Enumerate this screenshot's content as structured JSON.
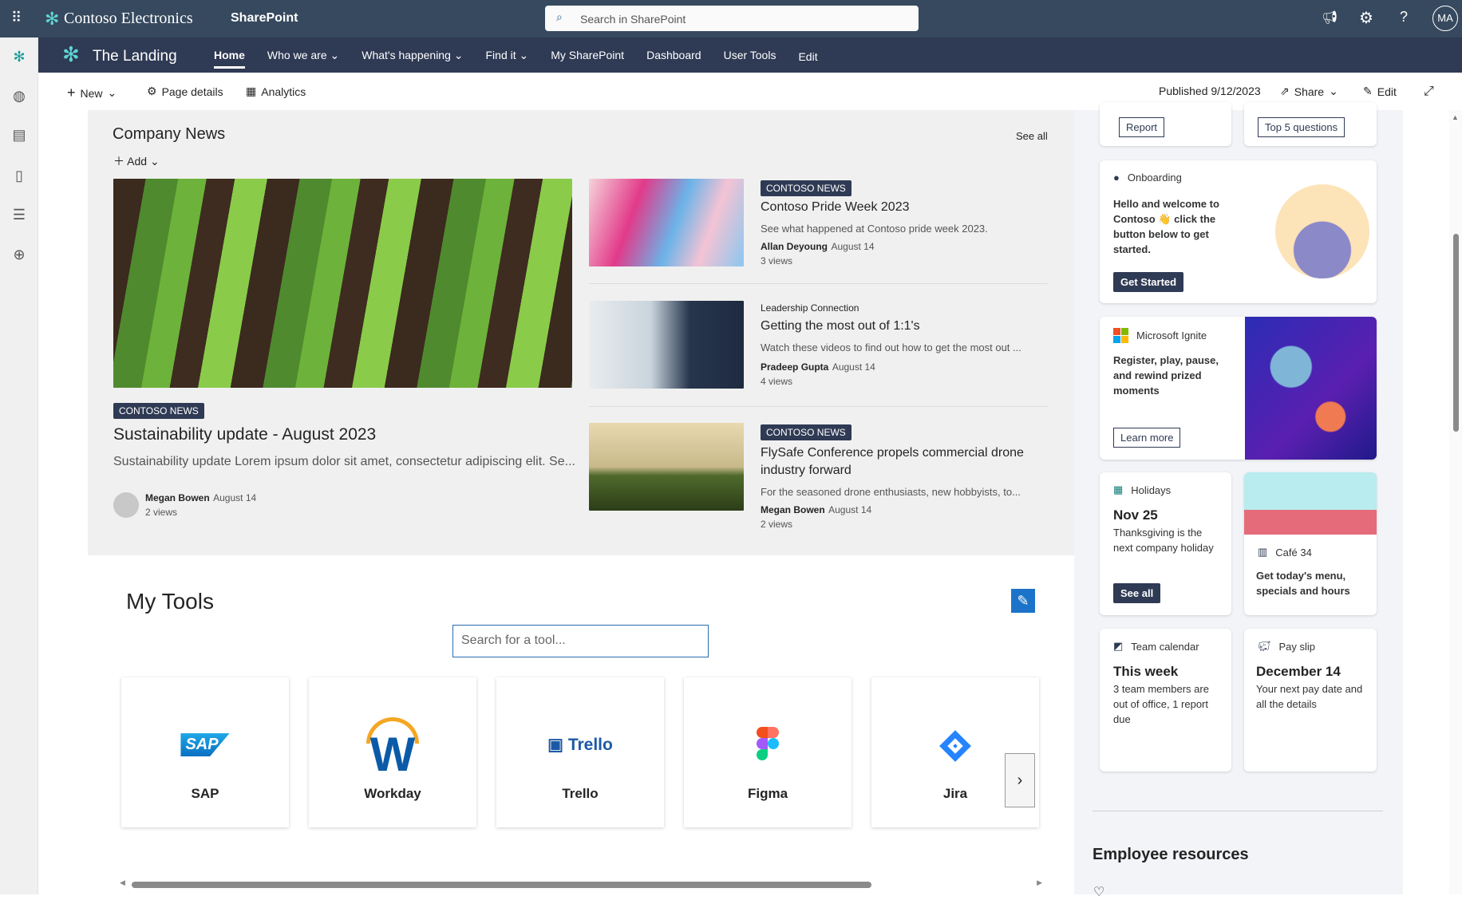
{
  "suite": {
    "org": "Contoso Electronics",
    "app": "SharePoint",
    "search_placeholder": "Search in SharePoint",
    "avatar": "MA"
  },
  "site": {
    "name": "The Landing",
    "nav": [
      {
        "label": "Home"
      },
      {
        "label": "Who we are"
      },
      {
        "label": "What's happening"
      },
      {
        "label": "Find it"
      },
      {
        "label": "My SharePoint"
      },
      {
        "label": "Dashboard"
      },
      {
        "label": "User Tools"
      },
      {
        "label": "Edit"
      }
    ]
  },
  "toolbar": {
    "new": "New",
    "page_details": "Page details",
    "analytics": "Analytics",
    "published": "Published 9/12/2023",
    "share": "Share",
    "edit": "Edit"
  },
  "news": {
    "title": "Company News",
    "see_all": "See all",
    "add": "Add",
    "hero": {
      "badge": "CONTOSO NEWS",
      "title": "Sustainability update - August 2023",
      "desc": "Sustainability update Lorem ipsum dolor sit amet, consectetur adipiscing elit. Se...",
      "author": "Megan Bowen",
      "date": "August 14",
      "views": "2 views"
    },
    "items": [
      {
        "badge": "CONTOSO NEWS",
        "title": "Contoso Pride Week 2023",
        "desc": "See what happened at Contoso pride week 2023.",
        "author": "Allan Deyoung",
        "date": "August 14",
        "views": "3 views"
      },
      {
        "category": "Leadership Connection",
        "title": "Getting the most out of 1:1's",
        "desc": "Watch these videos to find out how to get the most out ...",
        "author": "Pradeep Gupta",
        "date": "August 14",
        "views": "4 views"
      },
      {
        "badge": "CONTOSO NEWS",
        "title": "FlySafe Conference propels commercial drone industry forward",
        "desc": "For the seasoned drone enthusiasts, new hobbyists, to...",
        "author": "Megan Bowen",
        "date": "August 14",
        "views": "2 views"
      }
    ]
  },
  "tools": {
    "title": "My Tools",
    "search_placeholder": "Search for a tool...",
    "items": [
      {
        "label": "SAP"
      },
      {
        "label": "Workday"
      },
      {
        "label": "Trello"
      },
      {
        "label": "Figma"
      },
      {
        "label": "Jira"
      }
    ]
  },
  "right": {
    "report": "Report",
    "top5": "Top 5 questions",
    "onboarding": {
      "header": "Onboarding",
      "body": "Hello and welcome to Contoso 👋 click the button below to get started.",
      "button": "Get Started"
    },
    "ignite": {
      "header": "Microsoft Ignite",
      "body": "Register, play, pause, and rewind prized moments",
      "button": "Learn more"
    },
    "holidays": {
      "header": "Holidays",
      "big": "Nov 25",
      "body": "Thanksgiving is the next company holiday",
      "button": "See all"
    },
    "cafe": {
      "header": "Café 34",
      "body": "Get today's menu, specials and hours"
    },
    "calendar": {
      "header": "Team calendar",
      "big": "This week",
      "body": "3 team members are out of office, 1 report due"
    },
    "payslip": {
      "header": "Pay slip",
      "big": "December 14",
      "body": "Your next pay date and all the details"
    },
    "employee_resources": "Employee resources"
  }
}
